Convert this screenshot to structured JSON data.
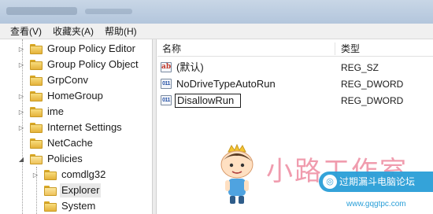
{
  "menubar": {
    "items": [
      "查看(V)",
      "收藏夹(A)",
      "帮助(H)"
    ]
  },
  "tree": {
    "items": [
      {
        "label": "Group Policy Editor",
        "expander": "▷"
      },
      {
        "label": "Group Policy Object",
        "expander": "▷"
      },
      {
        "label": "GrpConv",
        "expander": ""
      },
      {
        "label": "HomeGroup",
        "expander": "▷"
      },
      {
        "label": "ime",
        "expander": "▷"
      },
      {
        "label": "Internet Settings",
        "expander": "▷"
      },
      {
        "label": "NetCache",
        "expander": ""
      },
      {
        "label": "Policies",
        "expander": "◢"
      },
      {
        "label": "comdlg32",
        "expander": "▷"
      },
      {
        "label": "Explorer",
        "expander": "",
        "selected": true
      },
      {
        "label": "System",
        "expander": ""
      }
    ]
  },
  "list": {
    "columns": {
      "name": "名称",
      "type": "类型"
    },
    "rows": [
      {
        "icon": "ab",
        "name": "(默认)",
        "type": "REG_SZ"
      },
      {
        "icon": "011",
        "name": "NoDriveTypeAutoRun",
        "type": "REG_DWORD"
      },
      {
        "icon": "011",
        "name": "DisallowRun",
        "type": "REG_DWORD",
        "editing": true
      }
    ]
  },
  "watermark": {
    "brand_text": "小路工作室",
    "badge_text": "过期漏斗电脑论坛",
    "url": "www.gqgtpc.com"
  },
  "icons": {
    "folder": "folder-icon",
    "string_value": "reg-sz-icon",
    "dword_value": "reg-dword-icon"
  },
  "colors": {
    "accent": "#2a9fd8",
    "watermark_pink": "#ee8ba0",
    "folder": "#e4b23a"
  }
}
